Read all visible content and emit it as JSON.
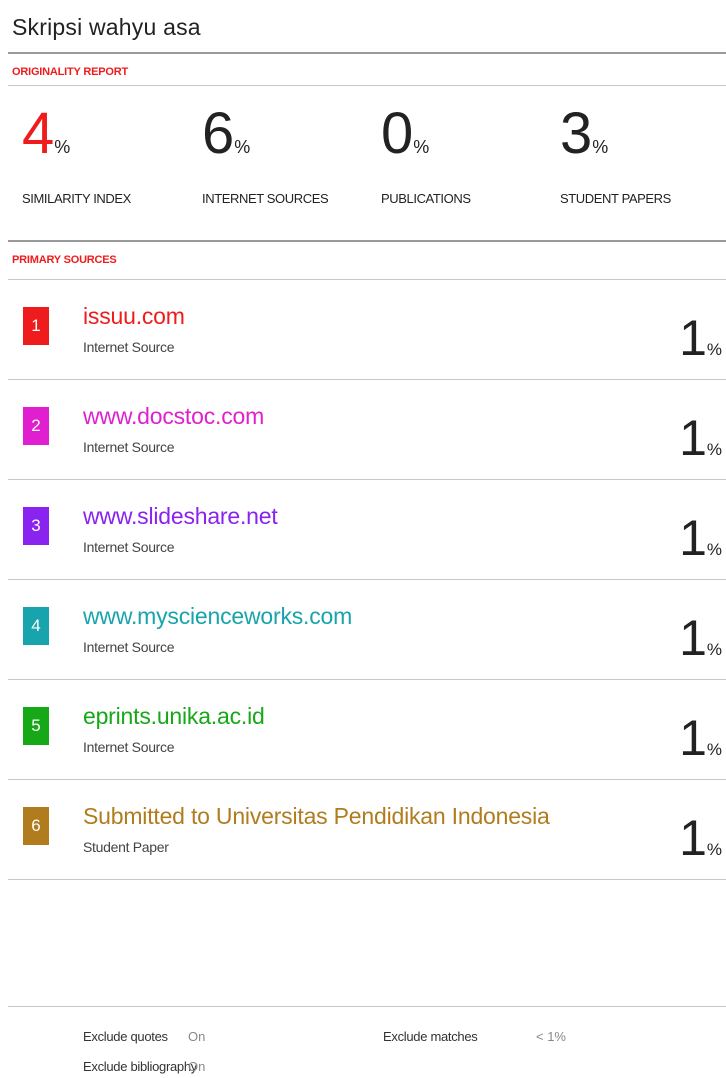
{
  "title": "Skripsi wahyu asa",
  "originality_label": "ORIGINALITY REPORT",
  "primary_label": "PRIMARY SOURCES",
  "stats": [
    {
      "value": "4",
      "unit": "%",
      "label": "SIMILARITY INDEX"
    },
    {
      "value": "6",
      "unit": "%",
      "label": "INTERNET SOURCES"
    },
    {
      "value": "0",
      "unit": "%",
      "label": "PUBLICATIONS"
    },
    {
      "value": "3",
      "unit": "%",
      "label": "STUDENT PAPERS"
    }
  ],
  "sources": [
    {
      "rank": "1",
      "name": "issuu.com",
      "type": "Internet Source",
      "percent": "1",
      "unit": "%",
      "color": "#ee1c1c"
    },
    {
      "rank": "2",
      "name": "www.docstoc.com",
      "type": "Internet Source",
      "percent": "1",
      "unit": "%",
      "color": "#e020d0"
    },
    {
      "rank": "3",
      "name": "www.slideshare.net",
      "type": "Internet Source",
      "percent": "1",
      "unit": "%",
      "color": "#8a22f0"
    },
    {
      "rank": "4",
      "name": "www.myscienceworks.com",
      "type": "Internet Source",
      "percent": "1",
      "unit": "%",
      "color": "#18a4ac"
    },
    {
      "rank": "5",
      "name": "eprints.unika.ac.id",
      "type": "Internet Source",
      "percent": "1",
      "unit": "%",
      "color": "#16a816"
    },
    {
      "rank": "6",
      "name": "Submitted to Universitas Pendidikan Indonesia",
      "type": "Student Paper",
      "percent": "1",
      "unit": "%",
      "color": "#b07c1e"
    }
  ],
  "footer": {
    "exclude_quotes_label": "Exclude quotes",
    "exclude_quotes_value": "On",
    "exclude_bibliography_label": "Exclude bibliography",
    "exclude_bibliography_value": "On",
    "exclude_matches_label": "Exclude matches",
    "exclude_matches_value": "< 1%"
  },
  "colors": {
    "accent_red": "#ee1c1c",
    "rule_gray": "#9a9a9a"
  }
}
